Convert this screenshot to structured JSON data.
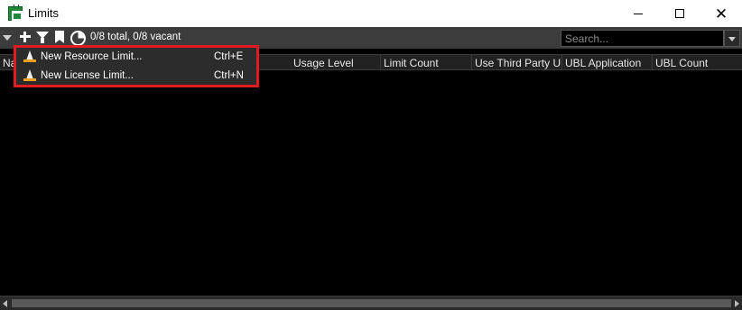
{
  "window": {
    "title": "Limits",
    "close_glyph": "✕"
  },
  "toolbar": {
    "status": "0/8 total, 0/8 vacant",
    "search_placeholder": "Search...",
    "icons": [
      "add-icon",
      "filter-icon",
      "bookmark-icon",
      "pie-chart-icon"
    ]
  },
  "table": {
    "columns": [
      "Na",
      "Usage Level",
      "Limit Count",
      "Use Third Party UBL",
      "UBL Application",
      "UBL Count"
    ]
  },
  "menu": {
    "items": [
      {
        "label": "New Resource Limit...",
        "shortcut": "Ctrl+E",
        "icon": "cone-icon"
      },
      {
        "label": "New License Limit...",
        "shortcut": "Ctrl+N",
        "icon": "cone-icon"
      }
    ],
    "highlight_color": "#e21b23"
  },
  "colors": {
    "background": "#000000",
    "toolbar": "#3c3c3c",
    "header": "#222222",
    "app_icon": "#1f8a3a"
  }
}
